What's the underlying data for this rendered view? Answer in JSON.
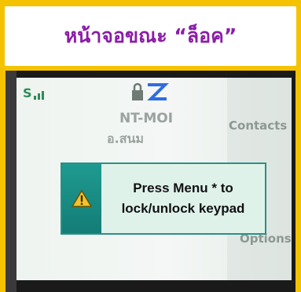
{
  "header": {
    "title": "หน้าจอขณะ “ล็อค”"
  },
  "status_bar": {
    "signal_icon": "signal-strength-icon",
    "lock_icon": "keypad-lock-icon"
  },
  "idle_screen": {
    "network_name": "NT-MOI",
    "location": "อ.สนม",
    "softkey_top": "Contacts",
    "softkey_bottom": "Options"
  },
  "dialog": {
    "icon": "warning-icon",
    "line1": "Press Menu * to",
    "line2": "lock/unlock keypad"
  },
  "colors": {
    "frame": "#f5c200",
    "title": "#8b1da8",
    "dialog_border": "#2d8f88",
    "dialog_accent": "#1f9a90",
    "warning": "#f2c230"
  }
}
